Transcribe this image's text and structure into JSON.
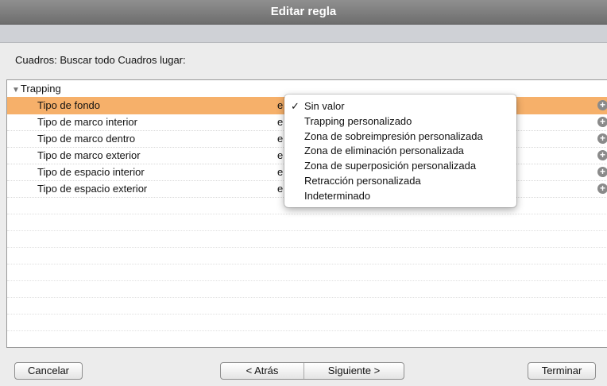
{
  "window": {
    "title": "Editar regla"
  },
  "rule_label": "Cuadros: Buscar todo Cuadros lugar:",
  "group": {
    "label": "Trapping",
    "toggle": "▼"
  },
  "rows": [
    {
      "label": "Tipo de fondo",
      "value": "e",
      "selected": true
    },
    {
      "label": "Tipo de marco interior",
      "value": "e"
    },
    {
      "label": "Tipo de marco dentro",
      "value": "e"
    },
    {
      "label": "Tipo de marco exterior",
      "value": "e"
    },
    {
      "label": "Tipo de espacio interior",
      "value": "e"
    },
    {
      "label": "Tipo de espacio exterior",
      "value": "e"
    }
  ],
  "add_icon": "plus-circle-icon",
  "popup": {
    "checkmark": "✓",
    "items": [
      "Sin valor",
      "Trapping personalizado",
      "Zona de sobreimpresión personalizada",
      "Zona de eliminación personalizada",
      "Zona de superposición personalizada",
      "Retracción personalizada",
      "Indeterminado"
    ],
    "selected_index": 0
  },
  "buttons": {
    "cancel": "Cancelar",
    "back": "< Atrás",
    "next": "Siguiente >",
    "finish": "Terminar"
  },
  "colors": {
    "selection": "#f6b06a",
    "titlebar": "#7d7d7d"
  }
}
